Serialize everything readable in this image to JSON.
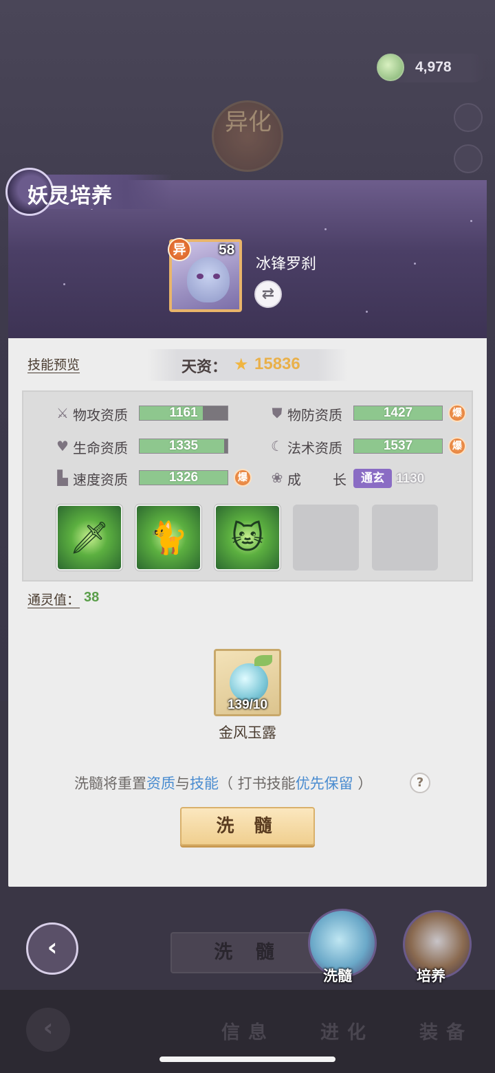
{
  "currency": {
    "value": "4,978",
    "icon": "jade-coin-icon"
  },
  "background": {
    "evolution_label": "异化",
    "bottom_button": "洗 髓",
    "wash_label": "洗髓",
    "train_label": "培养",
    "tabs": [
      "信息",
      "进化",
      "装备"
    ]
  },
  "panel": {
    "title": "妖灵培养",
    "pet": {
      "name": "冰锋罗刹",
      "level": "58",
      "rarity_badge": "异"
    },
    "skill_preview_label": "技能预览",
    "talent": {
      "label": "天资：",
      "value": "15836"
    },
    "stats": [
      {
        "label": "物攻资质",
        "value": "1161",
        "fill": 0.72,
        "icon": "sword-icon",
        "burst": ""
      },
      {
        "label": "物防资质",
        "value": "1427",
        "fill": 1.0,
        "icon": "shield-icon",
        "burst": "爆"
      },
      {
        "label": "生命资质",
        "value": "1335",
        "fill": 0.96,
        "icon": "heart-icon",
        "burst": ""
      },
      {
        "label": "法术资质",
        "value": "1537",
        "fill": 1.0,
        "icon": "magic-icon",
        "burst": "爆"
      },
      {
        "label": "速度资质",
        "value": "1326",
        "fill": 1.0,
        "icon": "boot-icon",
        "burst": "爆"
      }
    ],
    "growth": {
      "label_a": "成",
      "label_b": "长",
      "badge": "通玄",
      "value": "1130"
    },
    "skills": [
      {
        "icon": "blade-skill-icon",
        "filled": true
      },
      {
        "icon": "cat-flex-skill-icon",
        "filled": true
      },
      {
        "icon": "cat-meditate-skill-icon",
        "filled": true
      },
      {
        "icon": "",
        "filled": false
      },
      {
        "icon": "",
        "filled": false
      }
    ],
    "spirit": {
      "label": "通灵值：",
      "value": "38"
    },
    "item": {
      "name": "金风玉露",
      "count": "139/10"
    },
    "notice": {
      "part1": "洗髓将重置",
      "hl1": "资质",
      "part2": "与",
      "hl2": "技能",
      "part3": "（ 打书技能",
      "hl3": "优先保留",
      "part4": " ）"
    },
    "help": "?",
    "action_button": "洗 髓"
  },
  "colors": {
    "stat_fill": "#8ec78e",
    "burst": "#e07a38",
    "growth_badge": "#8a6cc4",
    "highlight": "#4a8cd0"
  }
}
